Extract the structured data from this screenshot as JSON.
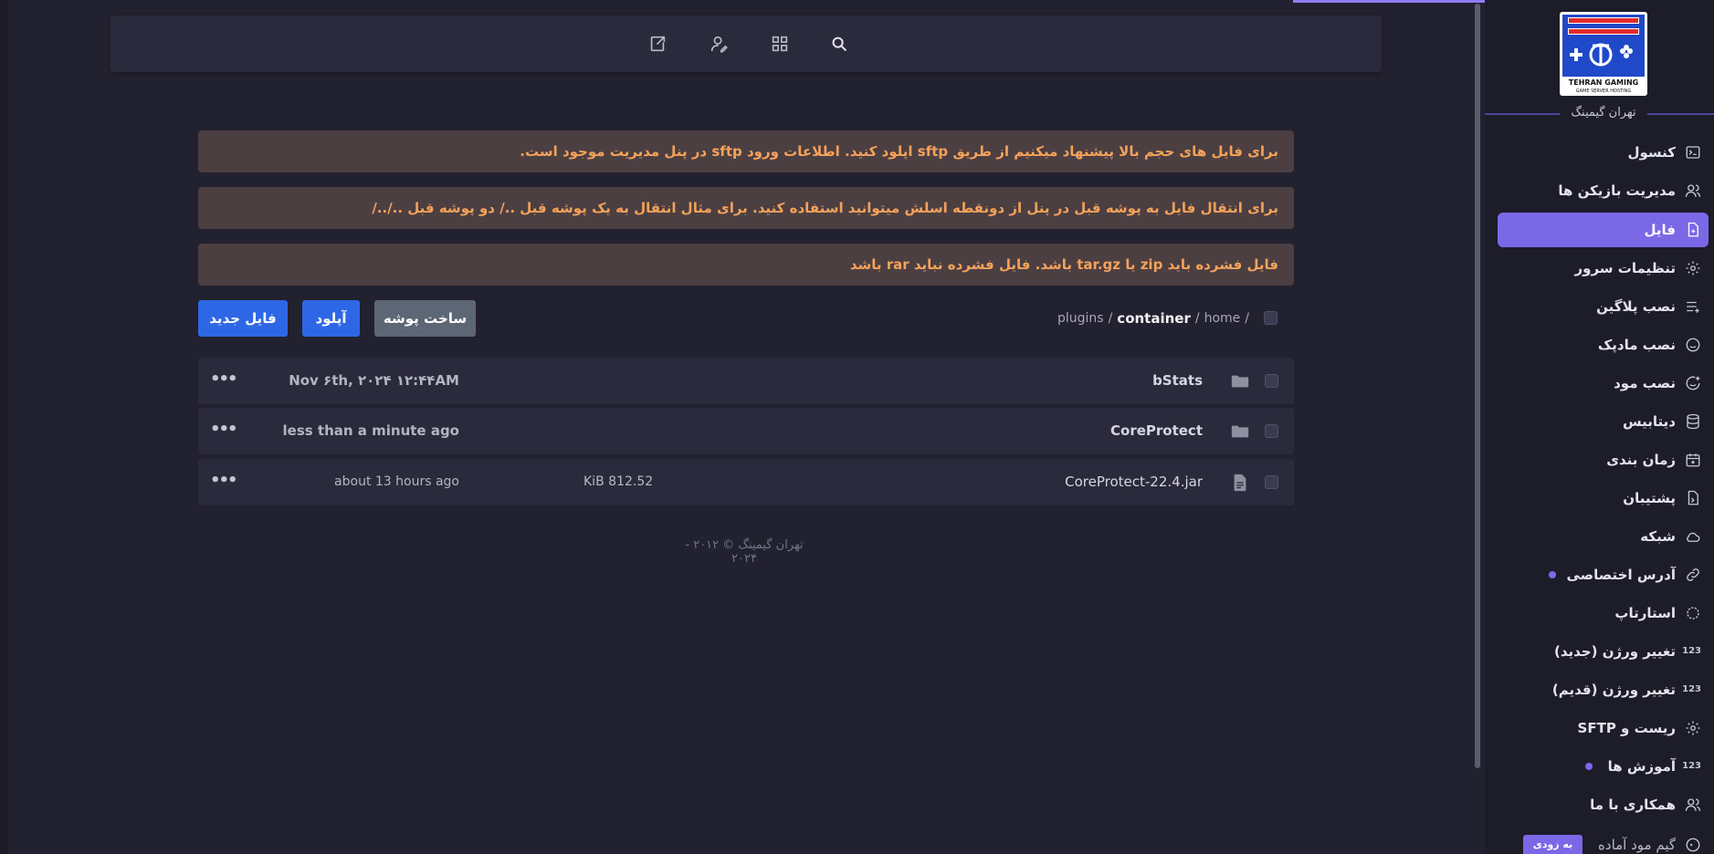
{
  "notices": [
    "برای فایل های حجم بالا پیشنهاد میکنیم از طریق sftp اپلود کنید. اطلاعات ورود sftp در پنل مدیریت موجود است.",
    "برای انتقال فایل به پوشه قبل در پنل از دونقطه اسلش میتوانید استفاده کنید. برای مثال انتقال به یک پوشه قبل ../ دو پوشه قبل ../../",
    "فایل فشرده باید zip یا tar.gz باشد. فایل فشرده نباید rar باشد"
  ],
  "breadcrumb": {
    "sep": "/",
    "home": "home",
    "container": "container",
    "plugins": "plugins"
  },
  "buttons": {
    "new_file": "فایل جدید",
    "upload": "آپلود",
    "new_folder": "ساخت پوشه"
  },
  "files": [
    {
      "name": "bStats",
      "type": "folder",
      "size": "",
      "modified": "Nov ۶th, ۲۰۲۴ ۱۲:۴۴AM"
    },
    {
      "name": "CoreProtect",
      "type": "folder",
      "size": "",
      "modified": "less than a minute ago"
    },
    {
      "name": "CoreProtect-22.4.jar",
      "type": "file",
      "size": "812.52 KiB",
      "modified": "about 13 hours ago"
    }
  ],
  "row_menu": "•••",
  "footer": "تهران گیمینگ © ۲۰۱۲ - ۲۰۲۴",
  "sidebar": {
    "logo_text": "TEHRAN GAMING",
    "logo_sub": "GAME SERVER HOSTING",
    "brand": "تهران گیمینگ",
    "items": [
      {
        "label": "کنسول",
        "icon": "terminal-icon"
      },
      {
        "label": "مدیریت بازیکن ها",
        "icon": "users-icon"
      },
      {
        "label": "فایل",
        "icon": "file-icon",
        "active": true
      },
      {
        "label": "تنظیمات سرور",
        "icon": "gear-icon"
      },
      {
        "label": "نصب پلاگین",
        "icon": "list-plus-icon"
      },
      {
        "label": "نصب مادپک",
        "icon": "smile-icon"
      },
      {
        "label": "نصب مود",
        "icon": "smile-plus-icon"
      },
      {
        "label": "دیتابیس",
        "icon": "database-icon"
      },
      {
        "label": "زمان بندی",
        "icon": "calendar-icon"
      },
      {
        "label": "پشتیبان",
        "icon": "file-archive-icon"
      },
      {
        "label": "شبکه",
        "icon": "cloud-icon"
      },
      {
        "label": "آدرس اختصاصی",
        "icon": "link-icon",
        "dot": true
      },
      {
        "label": "استارتاپ",
        "icon": "loader-icon"
      },
      {
        "label": "تغییر ورژن (جدید)",
        "icon": "123-icon",
        "icon_text": "123"
      },
      {
        "label": "تغییر ورژن (قدیم)",
        "icon": "123-icon",
        "icon_text": "123"
      },
      {
        "label": "ریست و SFTP",
        "icon": "gear-icon"
      },
      {
        "label": "آموزش ها",
        "icon": "123-icon",
        "icon_text": "123",
        "dot": true
      },
      {
        "label": "همکاری با ما",
        "icon": "users-icon"
      },
      {
        "label": "گیم مود آماده",
        "icon": "gamepad-icon"
      }
    ],
    "soon_badge": "به زودی"
  },
  "colors": {
    "accent": "#7a68e6",
    "primary_button": "#2e67e6",
    "notice_text": "#f5a25a",
    "notice_bg": "#4c3f42"
  }
}
